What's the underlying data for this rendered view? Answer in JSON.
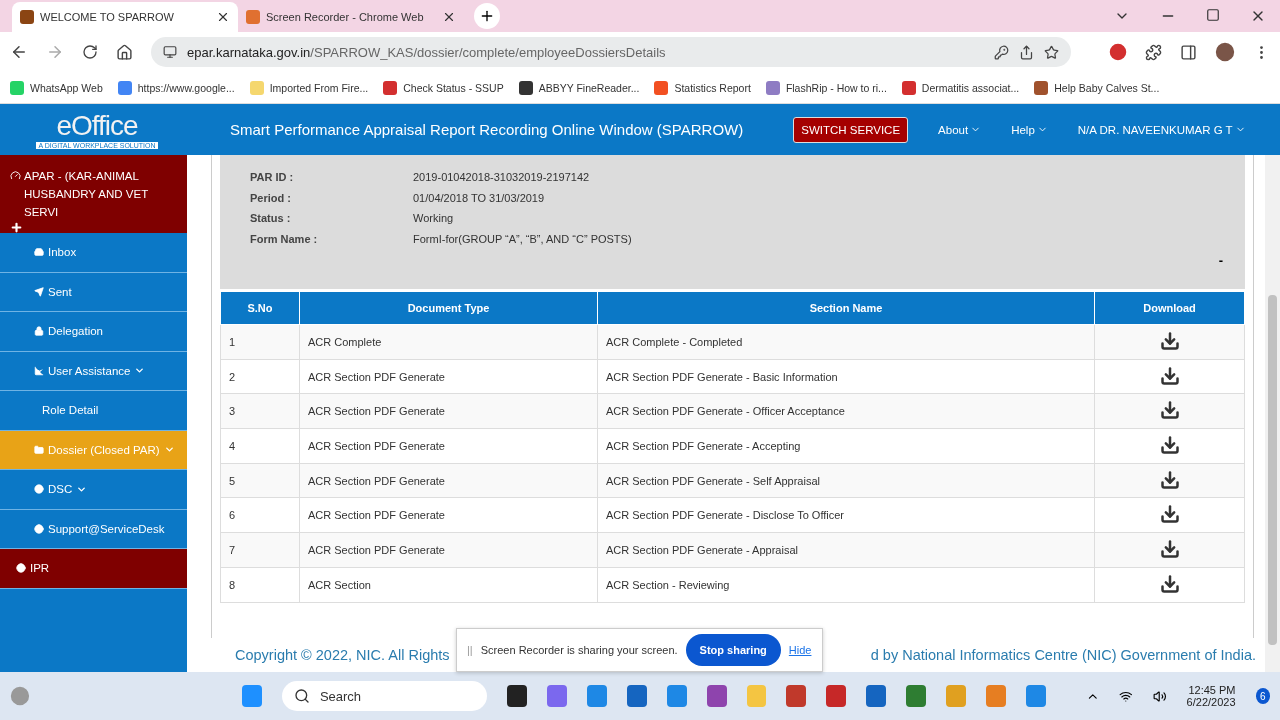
{
  "browser": {
    "tabs": [
      {
        "title": "WELCOME TO SPARROW",
        "selected": true
      },
      {
        "title": "Screen Recorder - Chrome Web",
        "selected": false
      }
    ],
    "url_host": "epar.karnataka.gov.in",
    "url_path": "/SPARROW_KAS/dossier/complete/employeeDossiersDetails",
    "bookmarks": [
      "WhatsApp Web",
      "https://www.google...",
      "Imported From Fire...",
      "Check Status - SSUP",
      "ABBYY FineReader...",
      "Statistics Report",
      "FlashRip - How to ri...",
      "Dermatitis associat...",
      "Help Baby Calves St..."
    ]
  },
  "header": {
    "logo": "eOffice",
    "tagline": "A DIGITAL WORKPLACE SOLUTION",
    "title": "Smart Performance Appraisal Report Recording Online Window (SPARROW)",
    "switch_button": "SWITCH SERVICE",
    "menus": [
      "About",
      "Help",
      "N/A DR. NAVEENKUMAR G T"
    ]
  },
  "sidebar": {
    "heading": "APAR - (KAR-ANIMAL HUSBANDRY AND VET SERVI",
    "items": [
      {
        "label": "Inbox",
        "kind": "nav",
        "selected": false,
        "caret": false
      },
      {
        "label": "Sent",
        "kind": "nav",
        "selected": false,
        "caret": false
      },
      {
        "label": "Delegation",
        "kind": "nav",
        "selected": false,
        "caret": false
      },
      {
        "label": "User Assistance",
        "kind": "nav",
        "selected": false,
        "caret": true
      },
      {
        "label": "Role Detail",
        "kind": "nav",
        "selected": false,
        "caret": false
      },
      {
        "label": "Dossier (Closed PAR)",
        "kind": "nav",
        "selected": true,
        "caret": true
      },
      {
        "label": "DSC",
        "kind": "nav",
        "selected": false,
        "caret": true
      },
      {
        "label": "Support@ServiceDesk",
        "kind": "nav",
        "selected": false,
        "caret": false
      },
      {
        "label": "IPR",
        "kind": "accent",
        "selected": false,
        "caret": false
      }
    ]
  },
  "details": [
    {
      "label": "PAR ID :",
      "value": "2019-01042018-31032019-2197142"
    },
    {
      "label": "Period :",
      "value": "01/04/2018 TO 31/03/2019"
    },
    {
      "label": "Status :",
      "value": "Working"
    },
    {
      "label": "Form Name :",
      "value": "FormI-for(GROUP “A”, “B”, AND “C” POSTS)"
    }
  ],
  "collapse": "-",
  "table": {
    "columns": [
      "S.No",
      "Document Type",
      "Section Name",
      "Download"
    ],
    "rows": [
      [
        "1",
        "ACR Complete",
        "ACR Complete - Completed"
      ],
      [
        "2",
        "ACR Section PDF Generate",
        "ACR Section PDF Generate - Basic Information"
      ],
      [
        "3",
        "ACR Section PDF Generate",
        "ACR Section PDF Generate - Officer Acceptance"
      ],
      [
        "4",
        "ACR Section PDF Generate",
        "ACR Section PDF Generate - Accepting"
      ],
      [
        "5",
        "ACR Section PDF Generate",
        "ACR Section PDF Generate - Self Appraisal"
      ],
      [
        "6",
        "ACR Section PDF Generate",
        "ACR Section PDF Generate - Disclose To Officer"
      ],
      [
        "7",
        "ACR Section PDF Generate",
        "ACR Section PDF Generate - Appraisal"
      ],
      [
        "8",
        "ACR Section",
        "ACR Section - Reviewing"
      ]
    ]
  },
  "footer": [
    "Copyright © 2022, NIC. All Rights",
    "d by National Informatics Centre (NIC) Government of India."
  ],
  "share_bar": {
    "handle": "||",
    "message": "Screen Recorder is sharing your screen.",
    "stop": "Stop sharing",
    "hide": "Hide"
  },
  "taskbar": {
    "search": "Search",
    "time": "12:45 PM",
    "date": "6/22/2023",
    "badge": "6"
  }
}
